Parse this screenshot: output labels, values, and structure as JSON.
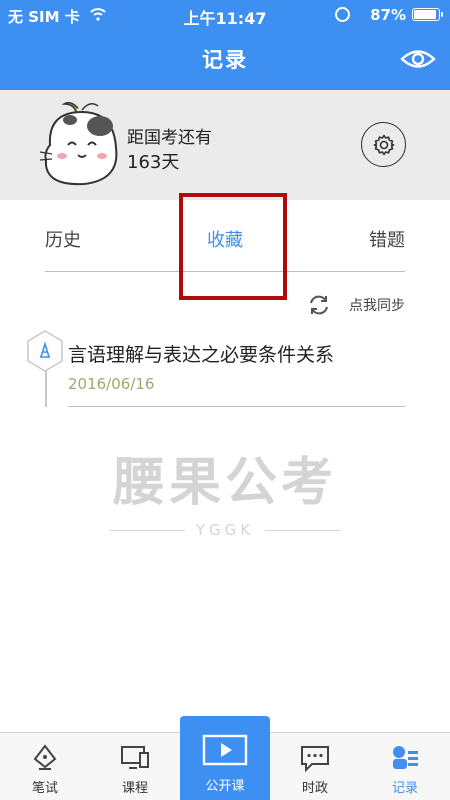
{
  "status_bar": {
    "carrier": "无 SIM 卡",
    "time": "上午11:47",
    "battery": "87%"
  },
  "nav": {
    "title": "记录",
    "right_icon": "eye-icon"
  },
  "profile": {
    "countdown_label": "距国考还有",
    "countdown_days": "163天",
    "settings_icon": "gear-icon"
  },
  "tabs": [
    {
      "label": "历史"
    },
    {
      "label": "收藏",
      "active": true
    },
    {
      "label": "错题"
    }
  ],
  "sync": {
    "label": "点我同步",
    "icon": "refresh-icon"
  },
  "records": [
    {
      "title": "言语理解与表达之必要条件关系",
      "date": "2016/06/16"
    }
  ],
  "watermark": {
    "main": "腰果公考",
    "sub": "YGGK"
  },
  "bottom_tabs": [
    {
      "label": "笔试",
      "icon": "pen-icon"
    },
    {
      "label": "课程",
      "icon": "monitor-icon"
    },
    {
      "label": "公开课",
      "icon": "play-icon"
    },
    {
      "label": "时政",
      "icon": "chat-icon"
    },
    {
      "label": "记录",
      "icon": "record-icon",
      "active": true
    }
  ],
  "colors": {
    "primary": "#3d8ff2",
    "highlight": "#b00a0a",
    "date": "#a1a86a",
    "header_bg": "#ebebeb"
  }
}
